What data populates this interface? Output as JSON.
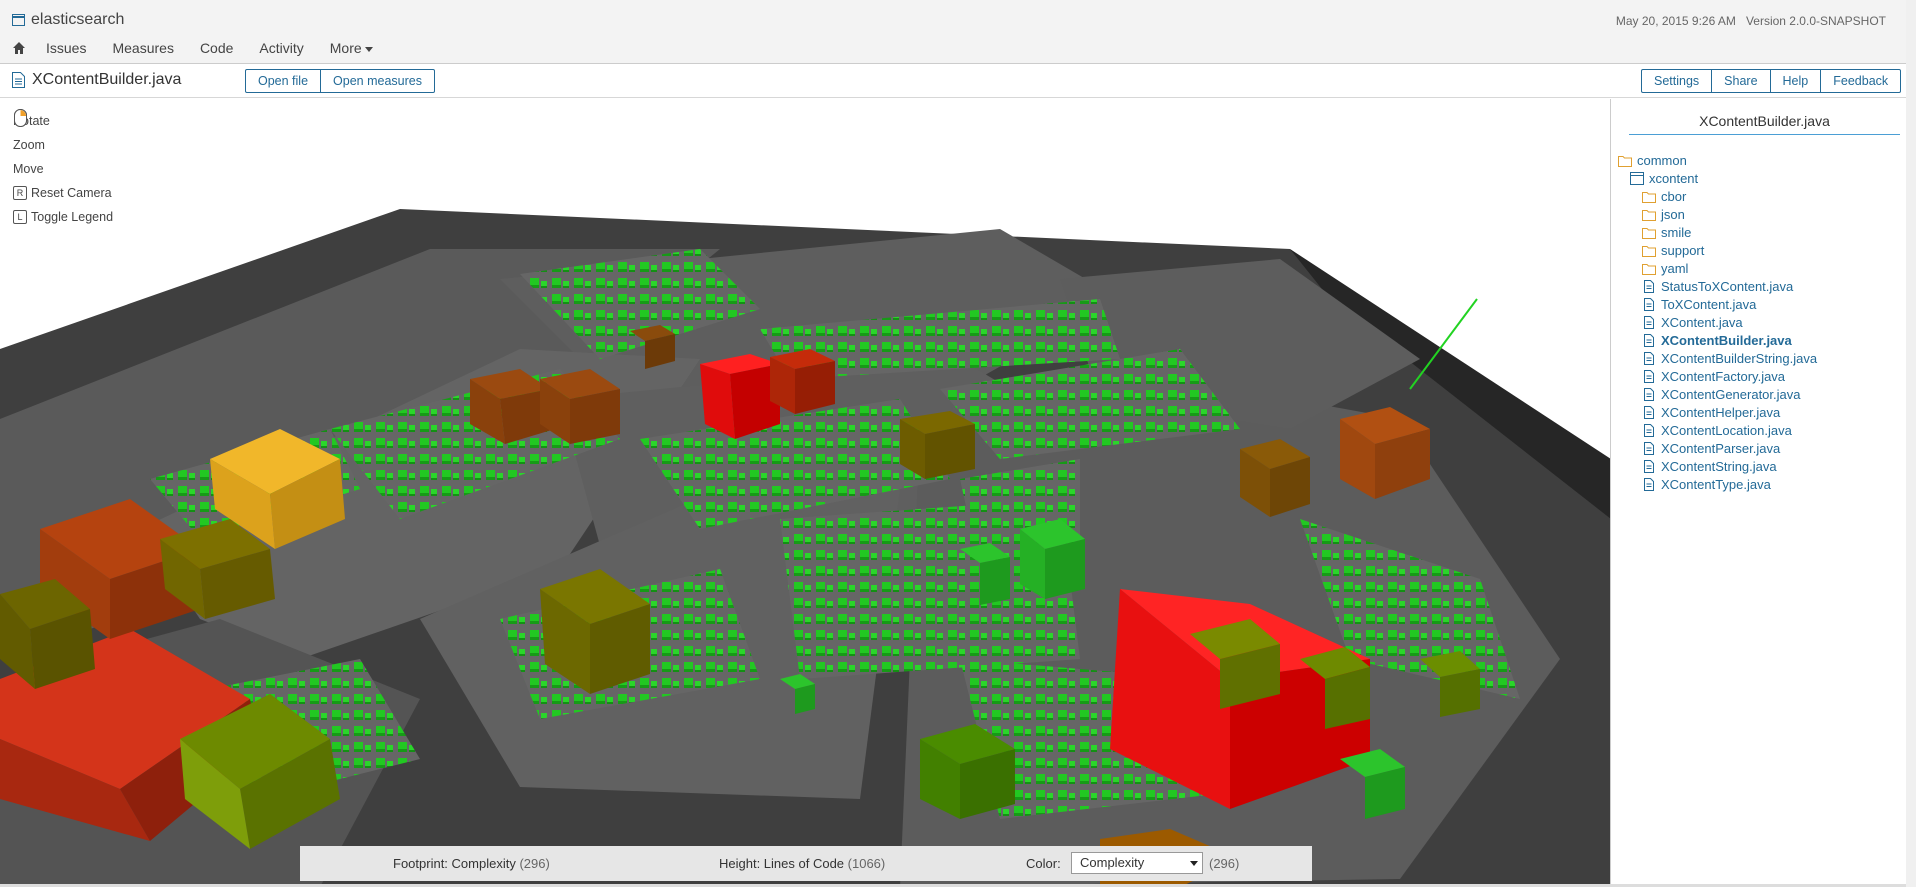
{
  "header": {
    "project": "elasticsearch",
    "date": "May 20, 2015 9:26 AM",
    "version": "Version 2.0.0-SNAPSHOT",
    "nav": [
      {
        "label": "Issues"
      },
      {
        "label": "Measures"
      },
      {
        "label": "Code"
      },
      {
        "label": "Activity"
      },
      {
        "label": "More"
      }
    ]
  },
  "file": {
    "name": "XContentBuilder.java",
    "open_file_label": "Open file",
    "open_measures_label": "Open measures",
    "settings_label": "Settings",
    "share_label": "Share",
    "help_label": "Help",
    "feedback_label": "Feedback"
  },
  "controls": {
    "rotate": "Rotate",
    "zoom": "Zoom",
    "move": "Move",
    "reset": "Reset Camera",
    "reset_key": "R",
    "legend": "Toggle Legend",
    "legend_key": "L"
  },
  "legend": {
    "footprint_label": "Footprint: Complexity",
    "footprint_value": "(296)",
    "height_label": "Height: Lines of Code",
    "height_value": "(1066)",
    "color_label": "Color:",
    "color_selected": "Complexity",
    "color_value": "(296)"
  },
  "tree": {
    "title": "XContentBuilder.java",
    "nodes": [
      {
        "label": "common",
        "type": "folder"
      },
      {
        "label": "xcontent",
        "type": "package"
      },
      {
        "label": "cbor",
        "type": "folder"
      },
      {
        "label": "json",
        "type": "folder"
      },
      {
        "label": "smile",
        "type": "folder"
      },
      {
        "label": "support",
        "type": "folder"
      },
      {
        "label": "yaml",
        "type": "folder"
      },
      {
        "label": "StatusToXContent.java",
        "type": "file"
      },
      {
        "label": "ToXContent.java",
        "type": "file"
      },
      {
        "label": "XContent.java",
        "type": "file"
      },
      {
        "label": "XContentBuilder.java",
        "type": "file",
        "active": true
      },
      {
        "label": "XContentBuilderString.java",
        "type": "file"
      },
      {
        "label": "XContentFactory.java",
        "type": "file"
      },
      {
        "label": "XContentGenerator.java",
        "type": "file"
      },
      {
        "label": "XContentHelper.java",
        "type": "file"
      },
      {
        "label": "XContentLocation.java",
        "type": "file"
      },
      {
        "label": "XContentParser.java",
        "type": "file"
      },
      {
        "label": "XContentString.java",
        "type": "file"
      },
      {
        "label": "XContentType.java",
        "type": "file"
      }
    ]
  },
  "colors": {
    "accent": "#236a97",
    "high": "#ff1a1a",
    "mid": "#8a6b00",
    "low": "#2cc42c",
    "ground": "#555555"
  },
  "icons": [
    "home-icon",
    "file-icon",
    "mouse-icon",
    "key-icon",
    "folder-icon",
    "package-icon"
  ]
}
